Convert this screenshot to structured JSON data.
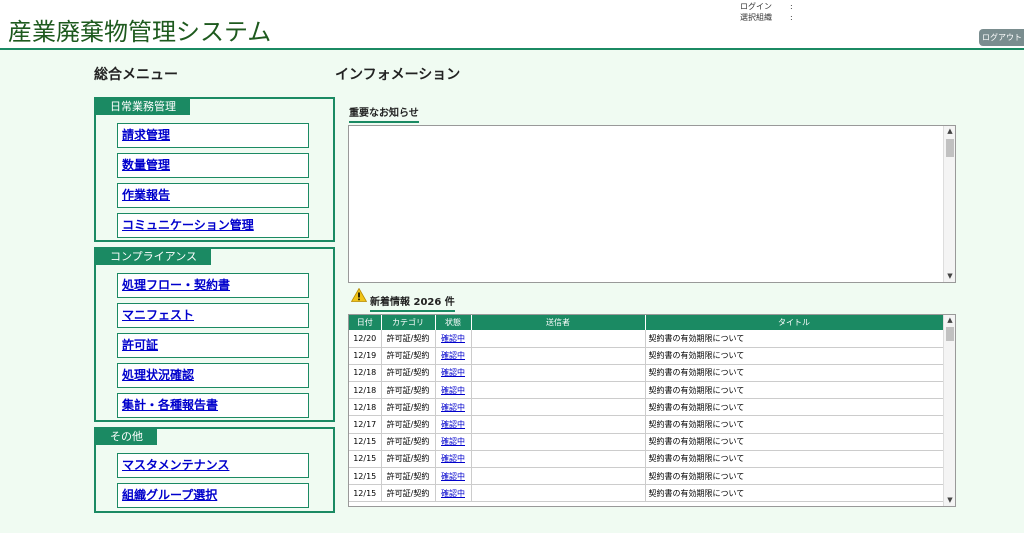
{
  "header": {
    "title": "産業廃棄物管理システム",
    "login_label": "ログイン",
    "login_value": ":",
    "org_label": "選択組織",
    "org_value": ":",
    "logout_label": "ログアウト"
  },
  "menu": {
    "heading": "総合メニュー",
    "groups": [
      {
        "label": "日常業務管理",
        "items": [
          "請求管理",
          "数量管理",
          "作業報告",
          "コミュニケーション管理"
        ]
      },
      {
        "label": "コンプライアンス",
        "items": [
          "処理フロー・契約書",
          "マニフェスト",
          "許可証",
          "処理状況確認",
          "集計・各種報告書"
        ]
      },
      {
        "label": "その他",
        "items": [
          "マスタメンテナンス",
          "組織グループ選択"
        ]
      }
    ]
  },
  "info": {
    "heading": "インフォメーション",
    "notice_heading": "重要なお知らせ",
    "news_heading": "新着情報 2026 件",
    "columns": [
      "日付",
      "カテゴリ",
      "状態",
      "送信者",
      "タイトル"
    ],
    "rows": [
      [
        "12/20",
        "許可証/契約",
        "確認中",
        "",
        "契約書の有効期限について"
      ],
      [
        "12/19",
        "許可証/契約",
        "確認中",
        "",
        "契約書の有効期限について"
      ],
      [
        "12/18",
        "許可証/契約",
        "確認中",
        "",
        "契約書の有効期限について"
      ],
      [
        "12/18",
        "許可証/契約",
        "確認中",
        "",
        "契約書の有効期限について"
      ],
      [
        "12/18",
        "許可証/契約",
        "確認中",
        "",
        "契約書の有効期限について"
      ],
      [
        "12/17",
        "許可証/契約",
        "確認中",
        "",
        "契約書の有効期限について"
      ],
      [
        "12/15",
        "許可証/契約",
        "確認中",
        "",
        "契約書の有効期限について"
      ],
      [
        "12/15",
        "許可証/契約",
        "確認中",
        "",
        "契約書の有効期限について"
      ],
      [
        "12/15",
        "許可証/契約",
        "確認中",
        "",
        "契約書の有効期限について"
      ],
      [
        "12/15",
        "許可証/契約",
        "確認中",
        "",
        "契約書の有効期限について"
      ]
    ]
  },
  "icons": {
    "warning": "warning-icon",
    "scroll_up": "scroll-up-icon",
    "scroll_down": "scroll-down-icon"
  },
  "colors": {
    "accent": "#1b8a63",
    "title": "#1e5a1e",
    "background": "#f0fbf2",
    "link": "#0000cc",
    "logout_bg": "#7a8d8f"
  }
}
